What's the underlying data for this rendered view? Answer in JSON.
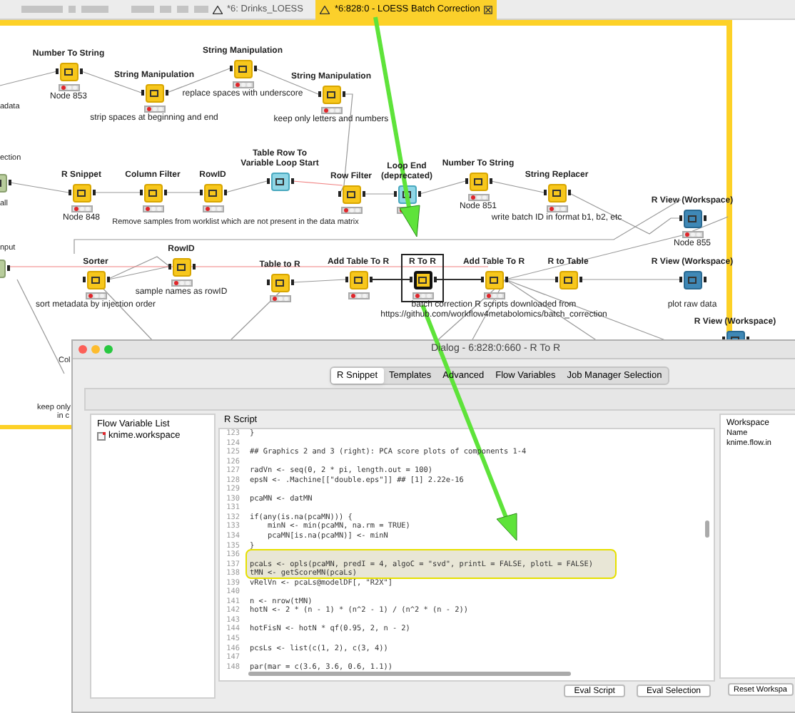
{
  "tabs": [
    {
      "label": "*6: Drinks_LOESS",
      "selected": false
    },
    {
      "label": "*6:828:0 - LOESS Batch Correction",
      "selected": true
    }
  ],
  "canvas": {
    "nodes": [
      {
        "label": "Number To String",
        "kind": "manipulator",
        "configured": false,
        "note": "Node 853",
        "selected": false
      },
      {
        "label": "String Manipulation",
        "kind": "manipulator",
        "configured": false,
        "note": "strip spaces at beginning and end",
        "selected": false
      },
      {
        "label": "String Manipulation",
        "kind": "manipulator",
        "configured": false,
        "note": "replace spaces with underscore",
        "selected": false
      },
      {
        "label": "String Manipulation",
        "kind": "manipulator",
        "configured": false,
        "note": "keep only letters and numbers",
        "selected": false
      },
      {
        "label": "R Snippet",
        "kind": "manipulator",
        "configured": false,
        "note": "Node 848",
        "selected": false
      },
      {
        "label": "Column Filter",
        "kind": "manipulator",
        "configured": false,
        "selected": false
      },
      {
        "label": "RowID",
        "kind": "manipulator",
        "configured": false,
        "selected": false
      },
      {
        "label": "Table Row To Variable Loop Start",
        "kind": "loop",
        "selected": false
      },
      {
        "label": "Row Filter",
        "kind": "manipulator",
        "configured": false,
        "selected": false
      },
      {
        "label": "Loop End (deprecated)",
        "kind": "loop",
        "configured": false,
        "selected": false
      },
      {
        "label": "Number To String",
        "kind": "manipulator",
        "configured": false,
        "note": "Node 851",
        "selected": false
      },
      {
        "label": "String Replacer",
        "kind": "manipulator",
        "configured": false,
        "note": "write batch ID in format b1, b2, etc",
        "selected": false
      },
      {
        "label": "R View (Workspace)",
        "kind": "view",
        "configured": false,
        "note": "Node 855",
        "selected": false
      },
      {
        "label": "Sorter",
        "kind": "manipulator",
        "configured": false,
        "note": "sort metadata by injection order",
        "selected": false
      },
      {
        "label": "RowID",
        "kind": "manipulator",
        "configured": false,
        "note": "sample names as rowID",
        "selected": false
      },
      {
        "label": "Table to R",
        "kind": "manipulator",
        "configured": false,
        "selected": false
      },
      {
        "label": "Add Table To R",
        "kind": "manipulator",
        "configured": false,
        "selected": false
      },
      {
        "label": "R To R",
        "kind": "manipulator",
        "configured": false,
        "selected": true
      },
      {
        "label": "Add Table To R",
        "kind": "manipulator",
        "configured": false,
        "note": "batch correction R scripts downloaded from https://github.com/workflow4metabolomics/batch_correction",
        "selected": false
      },
      {
        "label": "R to Table",
        "kind": "manipulator",
        "selected": false
      },
      {
        "label": "R View (Workspace)",
        "kind": "view",
        "note": "plot raw data",
        "selected": false
      },
      {
        "label": "R View (Workspace)",
        "kind": "view",
        "selected": false
      },
      {
        "kind": "source",
        "selected": false
      },
      {
        "kind": "source",
        "selected": false
      }
    ],
    "annotations": [
      "adata",
      "ection",
      "all",
      "nput",
      "Remove samples from worklist which are not present in the data matrix",
      "Col",
      "keep only",
      "in c"
    ]
  },
  "dialog": {
    "title": "Dialog - 6:828:0:660 - R To R",
    "tabs": [
      {
        "label": "R Snippet",
        "selected": true
      },
      {
        "label": "Templates",
        "selected": false
      },
      {
        "label": "Advanced",
        "selected": false
      },
      {
        "label": "Flow Variables",
        "selected": false
      },
      {
        "label": "Job Manager Selection",
        "selected": false
      }
    ],
    "flow_variables": {
      "title": "Flow Variable List",
      "items": [
        "knime.workspace"
      ]
    },
    "script": {
      "title": "R Script",
      "lines": [
        {
          "number": "123",
          "text": "}",
          "highlighted": false
        },
        {
          "number": "124",
          "highlighted": false
        },
        {
          "number": "125",
          "text": "## Graphics 2 and 3 (right): PCA score plots of components 1-4",
          "highlighted": false
        },
        {
          "number": "126",
          "highlighted": false
        },
        {
          "number": "127",
          "text": "radVn <- seq(0, 2 * pi, length.out = 100)",
          "highlighted": false
        },
        {
          "number": "128",
          "text": "epsN <- .Machine[[\"double.eps\"]] ## [1] 2.22e-16",
          "highlighted": false
        },
        {
          "number": "129",
          "highlighted": false
        },
        {
          "number": "130",
          "text": "pcaMN <- datMN",
          "highlighted": false
        },
        {
          "number": "131",
          "highlighted": false
        },
        {
          "number": "132",
          "text": "if(any(is.na(pcaMN))) {",
          "highlighted": false
        },
        {
          "number": "133",
          "text": "    minN <- min(pcaMN, na.rm = TRUE)",
          "highlighted": false
        },
        {
          "number": "134",
          "text": "    pcaMN[is.na(pcaMN)] <- minN",
          "highlighted": false
        },
        {
          "number": "135",
          "text": "}",
          "highlighted": false
        },
        {
          "number": "136",
          "highlighted": true
        },
        {
          "number": "137",
          "text": "pcaLs <- opls(pcaMN, predI = 4, algoC = \"svd\", printL = FALSE, plotL = FALSE)",
          "highlighted": true
        },
        {
          "number": "138",
          "text": "tMN <- getScoreMN(pcaLs)",
          "highlighted": true
        },
        {
          "number": "139",
          "text": "vRelVn <- pcaLs@modelDF[, \"R2X\"]",
          "highlighted": false
        },
        {
          "number": "140",
          "highlighted": false
        },
        {
          "number": "141",
          "text": "n <- nrow(tMN)",
          "highlighted": false
        },
        {
          "number": "142",
          "text": "hotN <- 2 * (n - 1) * (n^2 - 1) / (n^2 * (n - 2))",
          "highlighted": false
        },
        {
          "number": "143",
          "highlighted": false
        },
        {
          "number": "144",
          "text": "hotFisN <- hotN * qf(0.95, 2, n - 2)",
          "highlighted": false
        },
        {
          "number": "145",
          "highlighted": false
        },
        {
          "number": "146",
          "text": "pcsLs <- list(c(1, 2), c(3, 4))",
          "highlighted": false
        },
        {
          "number": "147",
          "highlighted": false
        },
        {
          "number": "148",
          "text": "par(mar = c(3.6, 3.6, 0.6, 1.1))",
          "highlighted": false
        }
      ],
      "buttons": [
        "Eval Script",
        "Eval Selection"
      ]
    },
    "workspace": {
      "title": "Workspace",
      "column": "Name",
      "items": [
        "knime.flow.in"
      ],
      "button": "Reset Workspa"
    }
  }
}
